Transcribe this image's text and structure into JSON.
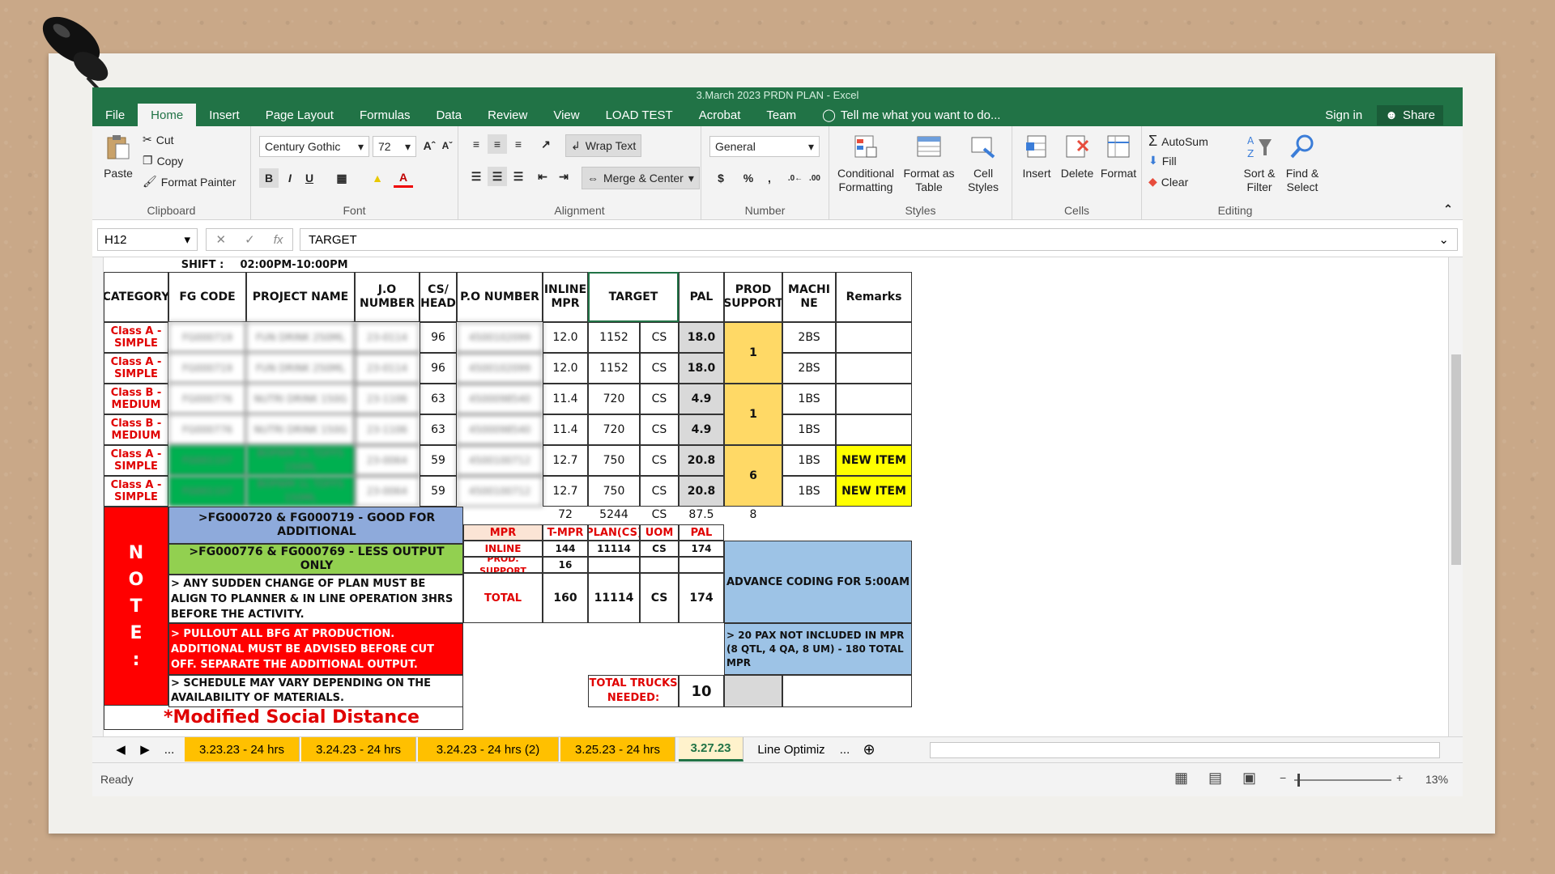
{
  "window": {
    "title": "3.March 2023 PRDN PLAN - Excel"
  },
  "tabs": [
    "File",
    "Home",
    "Insert",
    "Page Layout",
    "Formulas",
    "Data",
    "Review",
    "View",
    "LOAD TEST",
    "Acrobat",
    "Team"
  ],
  "active_tab": "Home",
  "tell_me": "Tell me what you want to do...",
  "sign_in": "Sign in",
  "share": "Share",
  "ribbon": {
    "clipboard": {
      "paste": "Paste",
      "cut": "Cut",
      "copy": "Copy",
      "format_painter": "Format Painter",
      "label": "Clipboard"
    },
    "font": {
      "name": "Century Gothic",
      "size": "72",
      "label": "Font"
    },
    "alignment": {
      "wrap": "Wrap Text",
      "merge": "Merge & Center",
      "label": "Alignment"
    },
    "number": {
      "format": "General",
      "currency": "$",
      "percent": "%",
      "comma": ",",
      "label": "Number"
    },
    "styles": {
      "cond1": "Conditional",
      "cond2": "Formatting",
      "fmt1": "Format as",
      "fmt2": "Table",
      "cell1": "Cell",
      "cell2": "Styles",
      "label": "Styles"
    },
    "cells": {
      "insert": "Insert",
      "delete": "Delete",
      "format": "Format",
      "label": "Cells"
    },
    "editing": {
      "autosum": "AutoSum",
      "fill": "Fill",
      "clear": "Clear",
      "sort1": "Sort &",
      "sort2": "Filter",
      "find1": "Find &",
      "find2": "Select",
      "label": "Editing"
    }
  },
  "formula_bar": {
    "cell": "H12",
    "fx": "fx",
    "value": "TARGET"
  },
  "sheet": {
    "shift_label": "SHIFT :",
    "shift_value": "02:00PM-10:00PM",
    "headers": {
      "category": "CATEGORY",
      "fg": "FG CODE",
      "project": "PROJECT NAME",
      "jo1": "J.O",
      "jo2": "NUMBER",
      "cs1": "CS/",
      "cs2": "HEAD",
      "po": "P.O NUMBER",
      "inline1": "INLINE",
      "inline2": "MPR",
      "target": "TARGET",
      "pal": "PAL",
      "prod1": "PROD",
      "prod2": "SUPPORT",
      "mach1": "MACHI",
      "mach2": "NE",
      "remarks": "Remarks"
    },
    "rows": [
      {
        "cat1": "Class A -",
        "cat2": "SIMPLE",
        "fg": "FG000719",
        "proj": "FUN DRINK 250ML",
        "jo": "23-0114",
        "cs": "96",
        "po": "4500102099",
        "mpr": "12.0",
        "target": "1152",
        "uom": "CS",
        "pal": "18.0",
        "mach": "2BS",
        "remarks": ""
      },
      {
        "cat1": "Class A -",
        "cat2": "SIMPLE",
        "fg": "FG000719",
        "proj": "FUN DRINK 250ML",
        "jo": "23-0114",
        "cs": "96",
        "po": "4500102099",
        "mpr": "12.0",
        "target": "1152",
        "uom": "CS",
        "pal": "18.0",
        "mach": "2BS",
        "remarks": ""
      },
      {
        "cat1": "Class B -",
        "cat2": "MEDIUM",
        "fg": "FG000776",
        "proj": "NUTRI DRINK 150G",
        "jo": "23-1106",
        "cs": "63",
        "po": "4500098540",
        "mpr": "11.4",
        "target": "720",
        "uom": "CS",
        "pal": "4.9",
        "mach": "1BS",
        "remarks": ""
      },
      {
        "cat1": "Class B -",
        "cat2": "MEDIUM",
        "fg": "FG000776",
        "proj": "NUTRI DRINK 150G",
        "jo": "23-1106",
        "cs": "63",
        "po": "4500098540",
        "mpr": "11.4",
        "target": "720",
        "uom": "CS",
        "pal": "4.9",
        "mach": "1BS",
        "remarks": ""
      },
      {
        "cat1": "Class A -",
        "cat2": "SIMPLE",
        "fg": "FG001107",
        "proj": "BOPWM 1L TDFFS 150ML",
        "jo": "23-0064",
        "cs": "59",
        "po": "4500100712",
        "mpr": "12.7",
        "target": "750",
        "uom": "CS",
        "pal": "20.8",
        "mach": "1BS",
        "remarks": "NEW ITEM"
      },
      {
        "cat1": "Class A -",
        "cat2": "SIMPLE",
        "fg": "FG001107",
        "proj": "BOPWM 1L TDFFS 150ML",
        "jo": "23-0064",
        "cs": "59",
        "po": "4500100712",
        "mpr": "12.7",
        "target": "750",
        "uom": "CS",
        "pal": "20.8",
        "mach": "1BS",
        "remarks": "NEW ITEM"
      }
    ],
    "prod_support": [
      "1",
      "1",
      "6"
    ],
    "totals": {
      "mpr": "72",
      "target": "5244",
      "uom": "CS",
      "pal": "87.5",
      "support": "8"
    },
    "note_letters": [
      "N",
      "O",
      "T",
      "E",
      ":"
    ],
    "notes": [
      ">FG000720 & FG000719 - GOOD FOR ADDITIONAL",
      ">FG000776 & FG000769 - LESS OUTPUT ONLY",
      "> ANY SUDDEN CHANGE OF PLAN MUST BE ALIGN TO PLANNER & IN LINE OPERATION 3HRS BEFORE THE ACTIVITY.",
      "> PULLOUT ALL BFG AT PRODUCTION. ADDITIONAL MUST BE ADVISED BEFORE CUT OFF. SEPARATE THE ADDITIONAL OUTPUT.",
      "> SCHEDULE MAY VARY DEPENDING ON THE AVAILABILITY OF MATERIALS."
    ],
    "social": "*Modified Social Distance",
    "summary": {
      "h_mpr": "MPR",
      "h_tmpr": "T-MPR",
      "h_plan": "PLAN(CS)",
      "h_uom": "UOM",
      "h_pal": "PAL",
      "inline_label": "INLINE",
      "inline_tmpr": "144",
      "inline_plan": "11114",
      "inline_uom": "CS",
      "inline_pal": "174",
      "support_label": "PROD. SUPPORT",
      "support_tmpr": "16",
      "total_label": "TOTAL",
      "total_tmpr": "160",
      "total_plan": "11114",
      "total_uom": "CS",
      "total_pal": "174"
    },
    "advance": "ADVANCE CODING FOR 5:00AM",
    "pax_note": "> 20 PAX NOT INCLUDED IN MPR (8 QTL, 4 QA, 8 UM) - 180 TOTAL MPR",
    "trucks_label": "TOTAL TRUCKS NEEDED:",
    "trucks_value": "10"
  },
  "sheet_tabs": [
    "3.23.23 - 24 hrs",
    "3.24.23 - 24 hrs",
    "3.24.23 - 24 hrs (2)",
    "3.25.23 - 24 hrs",
    "3.27.23",
    "Line Optimiz"
  ],
  "active_sheet": "3.27.23",
  "sheet_more": "...",
  "status": {
    "ready": "Ready",
    "zoom": "13%"
  },
  "colors": {
    "excel_green": "#217346",
    "sheet_tab": "#ffc000",
    "note_red": "#ff0000",
    "note_blue": "#8eaadb",
    "note_green": "#92d050",
    "yellow": "#ffff00",
    "support": "#ffd966",
    "advance_blue": "#9dc3e6"
  }
}
